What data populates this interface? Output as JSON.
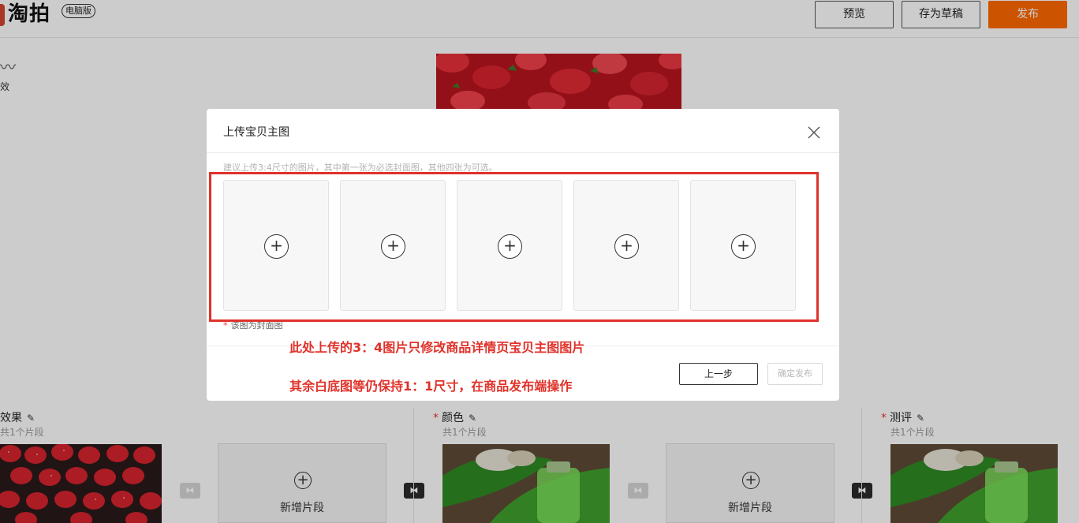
{
  "header": {
    "logo_text": "淘拍",
    "logo_badge": "电脑版",
    "preview_label": "预览",
    "draft_label": "存为草稿",
    "publish_label": "发布"
  },
  "side_tool": {
    "label": "效"
  },
  "bottom_strip": {
    "groups": [
      {
        "title": "效果",
        "required": false,
        "subtitle": "共1个片段"
      },
      {
        "title": "颜色",
        "required": true,
        "subtitle": "共1个片段"
      },
      {
        "title": "测评",
        "required": true,
        "subtitle": "共1个片段"
      }
    ],
    "add_segment_label": "新增片段"
  },
  "modal": {
    "title": "上传宝贝主图",
    "hint": "建议上传3:4尺寸的图片，其中第一张为必选封面图，其他四张为可选。",
    "slot_count": 5,
    "cover_note": "该图为封面图",
    "prev_label": "上一步",
    "confirm_label": "确定发布"
  },
  "annotation": {
    "line1": "此处上传的3：4图片只修改商品详情页宝贝主图图片",
    "line2": "其余白底图等仍保持1：1尺寸，在商品发布端操作",
    "color": "#e0322a"
  },
  "colors": {
    "accent": "#ff6a00",
    "required_star": "#e33333"
  }
}
